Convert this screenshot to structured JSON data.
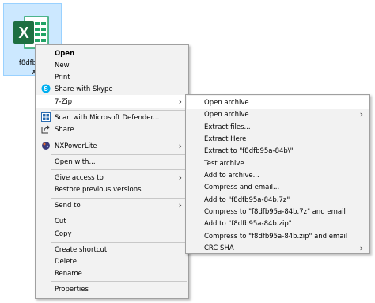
{
  "file": {
    "name_line1": "f8dfb95a",
    "name_line2": "x",
    "icon": "excel-file-icon"
  },
  "context_menu": {
    "items": [
      {
        "label": "Open",
        "bold": true
      },
      {
        "label": "New"
      },
      {
        "label": "Print"
      },
      {
        "label": "Share with Skype",
        "icon": "skype-icon"
      },
      {
        "label": "7-Zip",
        "submenu": true,
        "highlighted": true
      },
      {
        "label": "Scan with Microsoft Defender...",
        "icon": "defender-icon"
      },
      {
        "label": "Share",
        "icon": "share-icon"
      },
      {
        "label": "NXPowerLite",
        "icon": "nxpowerlite-icon",
        "submenu": true
      },
      {
        "label": "Open with..."
      },
      {
        "label": "Give access to",
        "submenu": true
      },
      {
        "label": "Restore previous versions"
      },
      {
        "label": "Send to",
        "submenu": true
      },
      {
        "label": "Cut"
      },
      {
        "label": "Copy"
      },
      {
        "label": "Create shortcut"
      },
      {
        "label": "Delete"
      },
      {
        "label": "Rename"
      },
      {
        "label": "Properties"
      }
    ]
  },
  "sevenzip_submenu": {
    "items": [
      {
        "label": "Open archive",
        "highlighted": true
      },
      {
        "label": "Open archive",
        "submenu": true
      },
      {
        "label": "Extract files..."
      },
      {
        "label": "Extract Here"
      },
      {
        "label": "Extract to \"f8dfb95a-84b\\\""
      },
      {
        "label": "Test archive"
      },
      {
        "label": "Add to archive..."
      },
      {
        "label": "Compress and email..."
      },
      {
        "label": "Add to \"f8dfb95a-84b.7z\""
      },
      {
        "label": "Compress to \"f8dfb95a-84b.7z\" and email"
      },
      {
        "label": "Add to \"f8dfb95a-84b.zip\""
      },
      {
        "label": "Compress to \"f8dfb95a-84b.zip\" and email"
      },
      {
        "label": "CRC SHA",
        "submenu": true
      }
    ]
  },
  "colors": {
    "menu_bg": "#f2f2f2",
    "selection_bg": "#cce8ff",
    "excel_green": "#1d6f42"
  }
}
